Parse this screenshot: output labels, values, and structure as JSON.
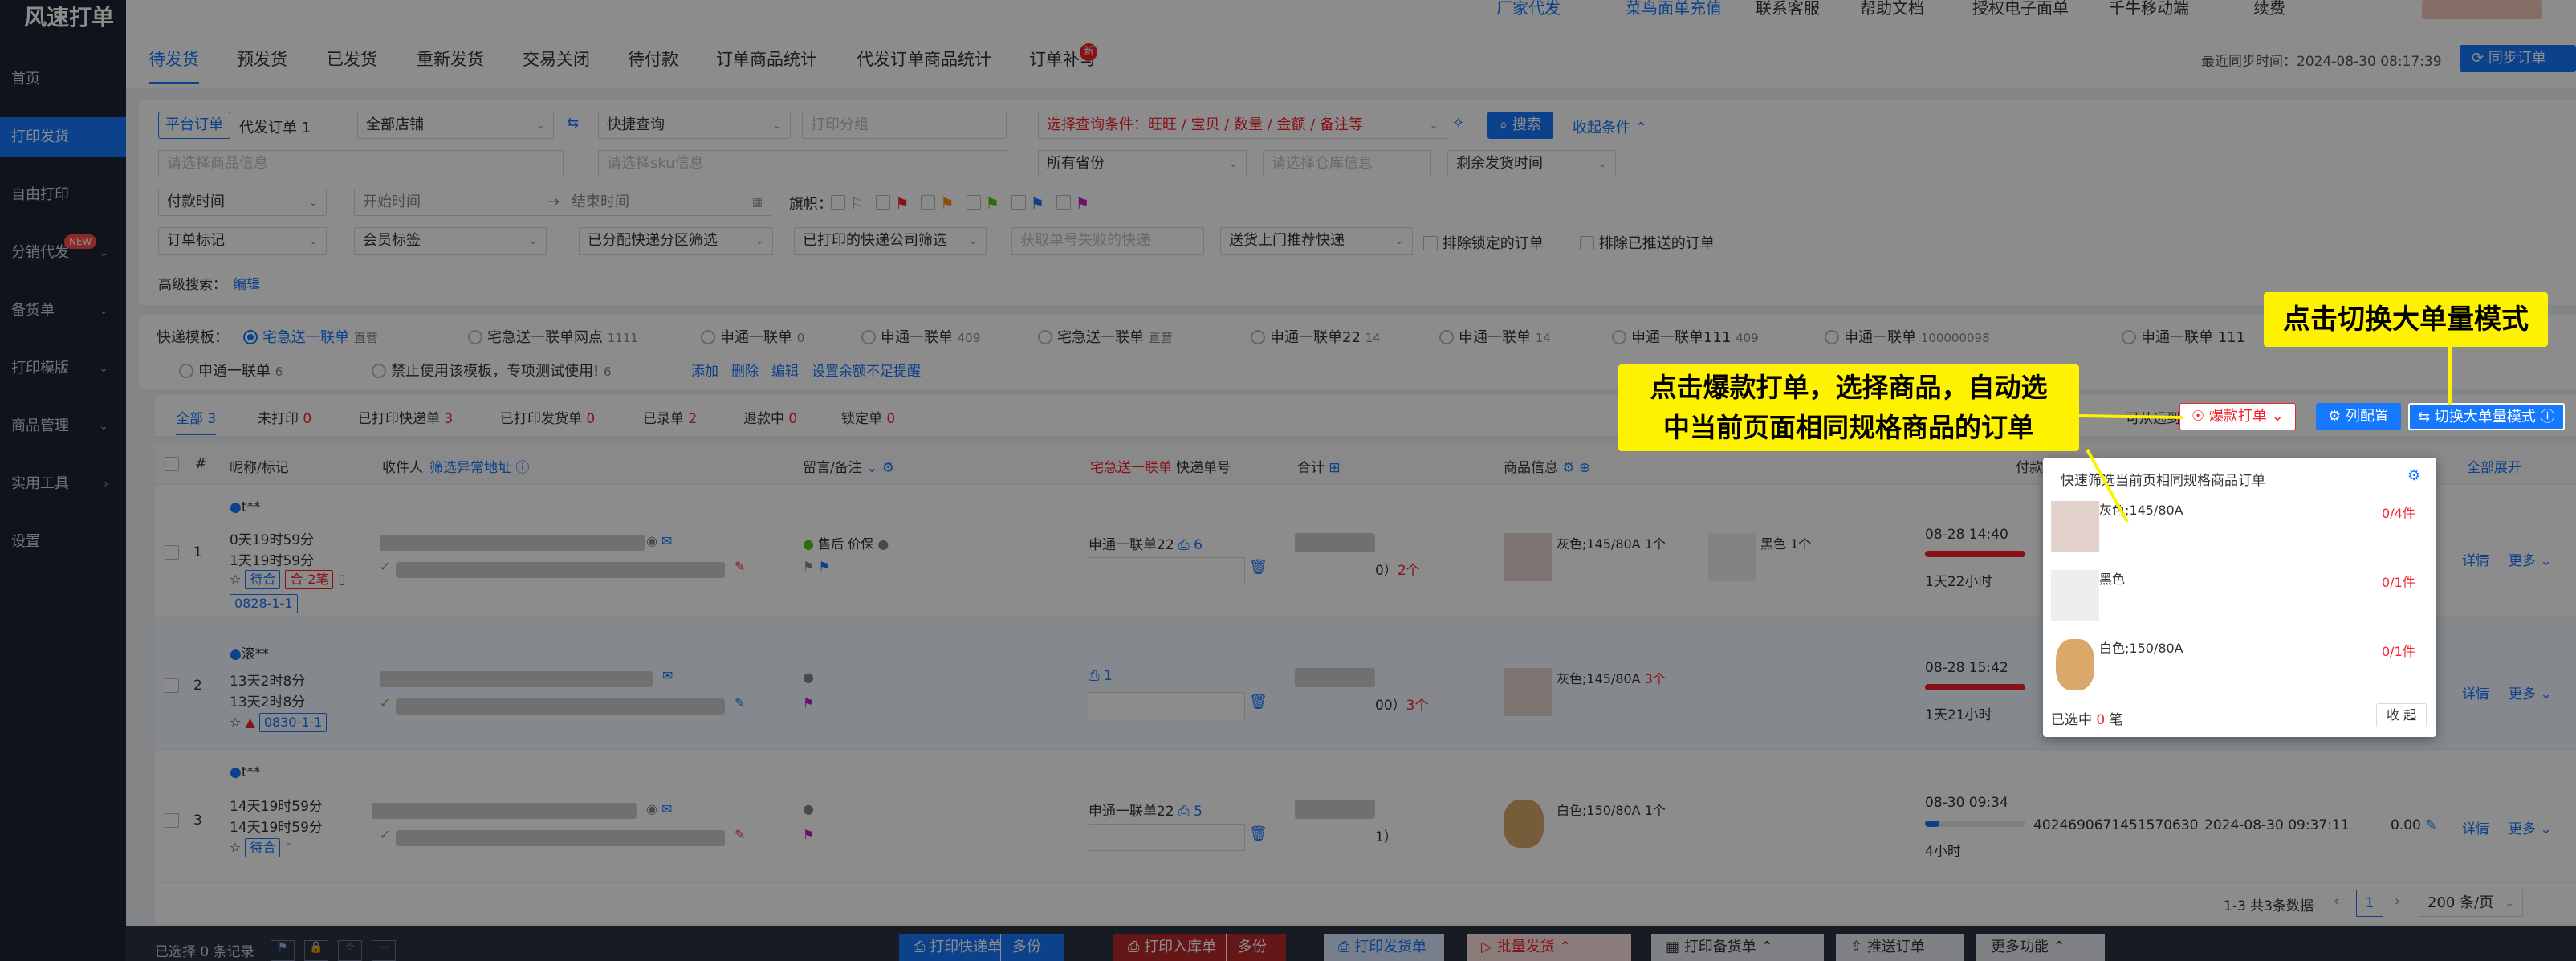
{
  "app": {
    "logo": "风速打单"
  },
  "sidebar": {
    "items": [
      {
        "label": "首页",
        "active": false,
        "chevron": false
      },
      {
        "label": "打印发货",
        "active": true,
        "chevron": false
      },
      {
        "label": "自由打印",
        "active": false,
        "chevron": false
      },
      {
        "label": "分销代发",
        "active": false,
        "chevron": true,
        "badge": "NEW"
      },
      {
        "label": "备货单",
        "active": false,
        "chevron": true
      },
      {
        "label": "打印模版",
        "active": false,
        "chevron": true
      },
      {
        "label": "商品管理",
        "active": false,
        "chevron": true
      },
      {
        "label": "实用工具",
        "active": false,
        "chevron": true
      },
      {
        "label": "设置",
        "active": false,
        "chevron": false
      }
    ]
  },
  "topbar": {
    "items": [
      "厂家代发",
      "菜鸟面单充值",
      "联系客服",
      "帮助文档",
      "授权电子面单",
      "千牛移动端",
      "续费"
    ]
  },
  "tabs": {
    "items": [
      "待发货",
      "预发货",
      "已发货",
      "重新发货",
      "交易关闭",
      "待付款",
      "订单商品统计",
      "代发订单商品统计",
      "订单补写"
    ],
    "badge": "新",
    "sync_time": "最近同步时间：2024-08-30 08:17:39",
    "sync_button": "同步订单"
  },
  "filters": {
    "platform_order": "平台订单",
    "proxy_order": "代发订单",
    "proxy_count": "1",
    "all_shops": "全部店铺",
    "quick_query": "快捷查询",
    "print_group_ph": "打印分组",
    "condition_ph": "选择查询条件：旺旺 / 宝贝 / 数量 / 金额 / 备注等",
    "search_button": "搜索",
    "collapse_link": "收起条件",
    "goods_info_ph": "请选择商品信息",
    "sku_info_ph": "请选择sku信息",
    "province": "所有省份",
    "warehouse_ph": "请选择仓库信息",
    "remaining_time": "剩余发货时间",
    "pay_time": "付款时间",
    "start_time_ph": "开始时间",
    "end_time_ph": "结束时间",
    "flag_label": "旗帜：",
    "order_mark": "订单标记",
    "member_tag": "会员标签",
    "express_zone": "已分配快递分区筛选",
    "printed_express": "已打印的快递公司筛选",
    "failed_no_ph": "获取单号失败的快递",
    "door_pickup": "送货上门推荐快递",
    "exclude_locked": "排除锁定的订单",
    "exclude_pushed": "排除已推送的订单",
    "advanced_search": "高级搜索：",
    "edit": "编辑"
  },
  "templates": {
    "label": "快递模板：",
    "items": [
      {
        "name": "宅急送一联单",
        "suffix": "直营",
        "selected": true
      },
      {
        "name": "宅急送一联单网点",
        "suffix": "1111"
      },
      {
        "name": "申通一联单",
        "suffix": "0"
      },
      {
        "name": "申通一联单",
        "suffix": "409"
      },
      {
        "name": "宅急送一联单",
        "suffix": "直营"
      },
      {
        "name": "申通一联单22",
        "suffix": "14"
      },
      {
        "name": "申通一联单",
        "suffix": "14"
      },
      {
        "name": "申通一联单111",
        "suffix": "409"
      },
      {
        "name": "申通一联单",
        "suffix": "100000098"
      },
      {
        "name": "申通一联单 111",
        "suffix": ""
      }
    ],
    "row2": [
      {
        "name": "申通一联单",
        "suffix": "6"
      },
      {
        "name": "禁止使用该模板，专项测试使用!",
        "suffix": "6"
      }
    ],
    "actions": [
      "添加",
      "删除",
      "编辑",
      "设置余额不足提醒"
    ]
  },
  "status_tabs": [
    {
      "label": "全部",
      "count": "3"
    },
    {
      "label": "未打印",
      "count": "0"
    },
    {
      "label": "已打印快递单",
      "count": "3"
    },
    {
      "label": "已打印发货单",
      "count": "0"
    },
    {
      "label": "已录单",
      "count": "2"
    },
    {
      "label": "退款中",
      "count": "0"
    },
    {
      "label": "锁定单",
      "count": "0"
    }
  ],
  "toolbar": {
    "near_far": "可从远到近",
    "hot_print": "爆款打单",
    "column_config": "列配置",
    "big_mode": "切换大单量模式",
    "expand_all": "全部展开"
  },
  "table": {
    "headers": [
      "#",
      "昵称/标记",
      "收件人",
      "筛选异常地址",
      "留言/备注",
      "宅急送一联单",
      "快递单号",
      "合计",
      "商品信息",
      "付款时间"
    ],
    "rows": [
      {
        "index": "1",
        "nick": "t**",
        "t1": "0天19时59分",
        "t2": "1天19时59分",
        "tags": [
          "待合",
          "合-2笔"
        ],
        "code": "0828-1-1",
        "remark": "售后 价保",
        "express": "申通一联单22",
        "track": "6",
        "total_suffix": "0）",
        "qty": "2个",
        "goods": [
          {
            "spec": "灰色;145/80A",
            "count": "1个"
          },
          {
            "spec": "黑色",
            "count": "1个"
          }
        ],
        "pay_time": "08-28 14:40",
        "remain": "1天22小时"
      },
      {
        "index": "2",
        "nick": "滚**",
        "t1": "13天2时8分",
        "t2": "13天2时8分",
        "tags": [],
        "code": "0830-1-1",
        "remark": "",
        "express": "",
        "track": "1",
        "total_suffix": "00）",
        "qty": "3个",
        "goods": [
          {
            "spec": "灰色;145/80A",
            "count": "3个"
          }
        ],
        "pay_time": "08-28 15:42",
        "remain": "1天21小时"
      },
      {
        "index": "3",
        "nick": "t**",
        "t1": "14天19时59分",
        "t2": "14天19时59分",
        "tags": [
          "待合"
        ],
        "code": "",
        "remark": "",
        "express": "申通一联单22",
        "track": "5",
        "total_suffix": "1）",
        "qty": "",
        "goods": [
          {
            "spec": "白色;150/80A",
            "count": "1个"
          }
        ],
        "pay_time": "08-30 09:34",
        "remain": "4小时",
        "order_no": "4024690671451570630",
        "created": "2024-08-30 09:37:11",
        "amount": "0.00"
      }
    ],
    "row_actions": {
      "detail": "详情",
      "more": "更多"
    }
  },
  "popup": {
    "title": "快速筛选当前页相同规格商品订单",
    "items": [
      {
        "spec": "灰色;145/80A",
        "count": "0/4件"
      },
      {
        "spec": "黑色",
        "count": "0/1件"
      },
      {
        "spec": "白色;150/80A",
        "count": "0/1件"
      }
    ],
    "selected_prefix": "已选中",
    "selected_count": "0",
    "selected_suffix": "笔",
    "collapse": "收 起"
  },
  "pagination": {
    "summary": "1-3 共3条数据",
    "page": "1",
    "per_page": "200 条/页"
  },
  "bottombar": {
    "selected": "已选择 0 条记录",
    "print_express": "打印快递单",
    "multi1": "多份",
    "print_inbound": "打印入库单",
    "multi2": "多份",
    "print_delivery": "打印发货单",
    "batch_ship": "批量发货",
    "print_stock": "打印备货单",
    "push_order": "推送订单",
    "more": "更多功能"
  },
  "callouts": {
    "big_mode": "点击切换大单量模式",
    "hot_print_line1": "点击爆款打单，选择商品，自动选",
    "hot_print_line2": "中当前页面相同规格商品的订单"
  },
  "colors": {
    "accent": "#1677ff",
    "sidebar": "#1d2533",
    "danger": "#f5222d",
    "callout": "#fff200"
  }
}
